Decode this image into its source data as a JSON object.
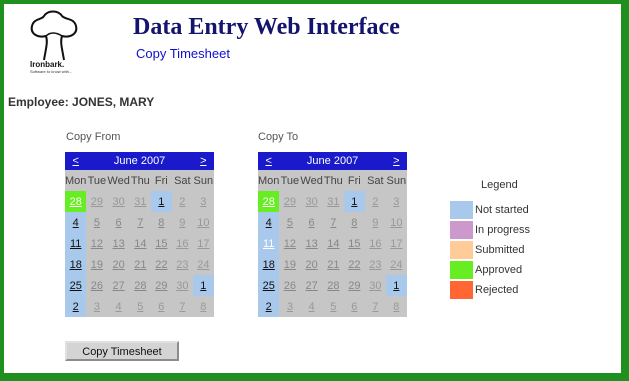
{
  "header": {
    "logo_text": "Ironbark.",
    "logo_tagline": "Software to know with...",
    "title": "Data Entry Web Interface",
    "subtitle": "Copy Timesheet"
  },
  "employee_label": "Employee: JONES, MARY",
  "copy_from": {
    "label": "Copy From",
    "prev": "<",
    "next": ">",
    "month": "June 2007",
    "dow": [
      "Mon",
      "Tue",
      "Wed",
      "Thu",
      "Fri",
      "Sat",
      "Sun"
    ],
    "weeks": [
      [
        {
          "d": "28",
          "s": "approved"
        },
        {
          "d": "29",
          "s": "out"
        },
        {
          "d": "30",
          "s": "out"
        },
        {
          "d": "31",
          "s": "out"
        },
        {
          "d": "1",
          "s": "notstarted"
        },
        {
          "d": "2",
          "s": "weekend"
        },
        {
          "d": "3",
          "s": "weekend"
        }
      ],
      [
        {
          "d": "4",
          "s": "notstarted"
        },
        {
          "d": "5",
          "s": "plain"
        },
        {
          "d": "6",
          "s": "plain"
        },
        {
          "d": "7",
          "s": "plain"
        },
        {
          "d": "8",
          "s": "plain"
        },
        {
          "d": "9",
          "s": "weekend"
        },
        {
          "d": "10",
          "s": "weekend"
        }
      ],
      [
        {
          "d": "11",
          "s": "notstarted"
        },
        {
          "d": "12",
          "s": "plain"
        },
        {
          "d": "13",
          "s": "plain"
        },
        {
          "d": "14",
          "s": "plain"
        },
        {
          "d": "15",
          "s": "plain"
        },
        {
          "d": "16",
          "s": "weekend"
        },
        {
          "d": "17",
          "s": "weekend"
        }
      ],
      [
        {
          "d": "18",
          "s": "notstarted"
        },
        {
          "d": "19",
          "s": "plain"
        },
        {
          "d": "20",
          "s": "plain"
        },
        {
          "d": "21",
          "s": "plain"
        },
        {
          "d": "22",
          "s": "plain"
        },
        {
          "d": "23",
          "s": "weekend"
        },
        {
          "d": "24",
          "s": "weekend"
        }
      ],
      [
        {
          "d": "25",
          "s": "notstarted"
        },
        {
          "d": "26",
          "s": "plain"
        },
        {
          "d": "27",
          "s": "plain"
        },
        {
          "d": "28",
          "s": "plain"
        },
        {
          "d": "29",
          "s": "plain"
        },
        {
          "d": "30",
          "s": "weekend"
        },
        {
          "d": "1",
          "s": "notstarted"
        }
      ],
      [
        {
          "d": "2",
          "s": "notstarted"
        },
        {
          "d": "3",
          "s": "out"
        },
        {
          "d": "4",
          "s": "out"
        },
        {
          "d": "5",
          "s": "out"
        },
        {
          "d": "6",
          "s": "out"
        },
        {
          "d": "7",
          "s": "out"
        },
        {
          "d": "8",
          "s": "out"
        }
      ]
    ]
  },
  "copy_to": {
    "label": "Copy To",
    "prev": "<",
    "next": ">",
    "month": "June 2007",
    "dow": [
      "Mon",
      "Tue",
      "Wed",
      "Thu",
      "Fri",
      "Sat",
      "Sun"
    ],
    "weeks": [
      [
        {
          "d": "28",
          "s": "approved"
        },
        {
          "d": "29",
          "s": "out"
        },
        {
          "d": "30",
          "s": "out"
        },
        {
          "d": "31",
          "s": "out"
        },
        {
          "d": "1",
          "s": "notstarted"
        },
        {
          "d": "2",
          "s": "weekend"
        },
        {
          "d": "3",
          "s": "weekend"
        }
      ],
      [
        {
          "d": "4",
          "s": "notstarted"
        },
        {
          "d": "5",
          "s": "plain"
        },
        {
          "d": "6",
          "s": "plain"
        },
        {
          "d": "7",
          "s": "plain"
        },
        {
          "d": "8",
          "s": "plain"
        },
        {
          "d": "9",
          "s": "weekend"
        },
        {
          "d": "10",
          "s": "weekend"
        }
      ],
      [
        {
          "d": "11",
          "s": "notstarted-light"
        },
        {
          "d": "12",
          "s": "plain"
        },
        {
          "d": "13",
          "s": "plain"
        },
        {
          "d": "14",
          "s": "plain"
        },
        {
          "d": "15",
          "s": "plain"
        },
        {
          "d": "16",
          "s": "weekend"
        },
        {
          "d": "17",
          "s": "weekend"
        }
      ],
      [
        {
          "d": "18",
          "s": "notstarted"
        },
        {
          "d": "19",
          "s": "plain"
        },
        {
          "d": "20",
          "s": "plain"
        },
        {
          "d": "21",
          "s": "plain"
        },
        {
          "d": "22",
          "s": "plain"
        },
        {
          "d": "23",
          "s": "weekend"
        },
        {
          "d": "24",
          "s": "weekend"
        }
      ],
      [
        {
          "d": "25",
          "s": "notstarted"
        },
        {
          "d": "26",
          "s": "plain"
        },
        {
          "d": "27",
          "s": "plain"
        },
        {
          "d": "28",
          "s": "plain"
        },
        {
          "d": "29",
          "s": "plain"
        },
        {
          "d": "30",
          "s": "weekend"
        },
        {
          "d": "1",
          "s": "notstarted"
        }
      ],
      [
        {
          "d": "2",
          "s": "notstarted"
        },
        {
          "d": "3",
          "s": "out"
        },
        {
          "d": "4",
          "s": "out"
        },
        {
          "d": "5",
          "s": "out"
        },
        {
          "d": "6",
          "s": "out"
        },
        {
          "d": "7",
          "s": "out"
        },
        {
          "d": "8",
          "s": "out"
        }
      ]
    ]
  },
  "legend": {
    "title": "Legend",
    "items": [
      {
        "label": "Not started",
        "color": "#a8c8ec"
      },
      {
        "label": "In progress",
        "color": "#cc99cc"
      },
      {
        "label": "Submitted",
        "color": "#ffcc99"
      },
      {
        "label": "Approved",
        "color": "#66ee22"
      },
      {
        "label": "Rejected",
        "color": "#ff6633"
      }
    ]
  },
  "colors": {
    "border_green": "#1f8f1f",
    "calendar_header": "#1a1acc",
    "calendar_cell": "#c6c6c6"
  },
  "copy_button_label": "Copy Timesheet"
}
